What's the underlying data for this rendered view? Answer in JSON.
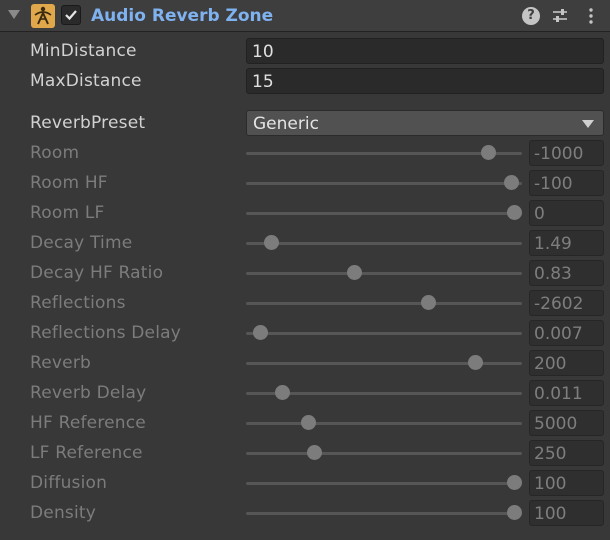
{
  "component": {
    "title": "Audio Reverb Zone",
    "enabled": true,
    "icon": "audio-reverb-zone-icon"
  },
  "header_icons": [
    "help-icon",
    "presets-icon",
    "context-menu-icon"
  ],
  "fields": {
    "min_distance": {
      "label": "MinDistance",
      "value": "10"
    },
    "max_distance": {
      "label": "MaxDistance",
      "value": "15"
    },
    "reverb_preset": {
      "label": "ReverbPreset",
      "value": "Generic"
    }
  },
  "sliders": [
    {
      "id": "room",
      "label": "Room",
      "value": "-1000",
      "fraction": 0.875
    },
    {
      "id": "room-hf",
      "label": "Room HF",
      "value": "-100",
      "fraction": 0.96
    },
    {
      "id": "room-lf",
      "label": "Room LF",
      "value": "0",
      "fraction": 0.97
    },
    {
      "id": "decay-time",
      "label": "Decay Time",
      "value": "1.49",
      "fraction": 0.09
    },
    {
      "id": "decay-hf-ratio",
      "label": "Decay HF Ratio",
      "value": "0.83",
      "fraction": 0.39
    },
    {
      "id": "reflections",
      "label": "Reflections",
      "value": "-2602",
      "fraction": 0.66
    },
    {
      "id": "reflections-delay",
      "label": "Reflections Delay",
      "value": "0.007",
      "fraction": 0.05
    },
    {
      "id": "reverb",
      "label": "Reverb",
      "value": "200",
      "fraction": 0.83
    },
    {
      "id": "reverb-delay",
      "label": "Reverb Delay",
      "value": "0.011",
      "fraction": 0.13
    },
    {
      "id": "hf-reference",
      "label": "HF Reference",
      "value": "5000",
      "fraction": 0.225
    },
    {
      "id": "lf-reference",
      "label": "LF Reference",
      "value": "250",
      "fraction": 0.245
    },
    {
      "id": "diffusion",
      "label": "Diffusion",
      "value": "100",
      "fraction": 0.97
    },
    {
      "id": "density",
      "label": "Density",
      "value": "100",
      "fraction": 0.97
    }
  ]
}
